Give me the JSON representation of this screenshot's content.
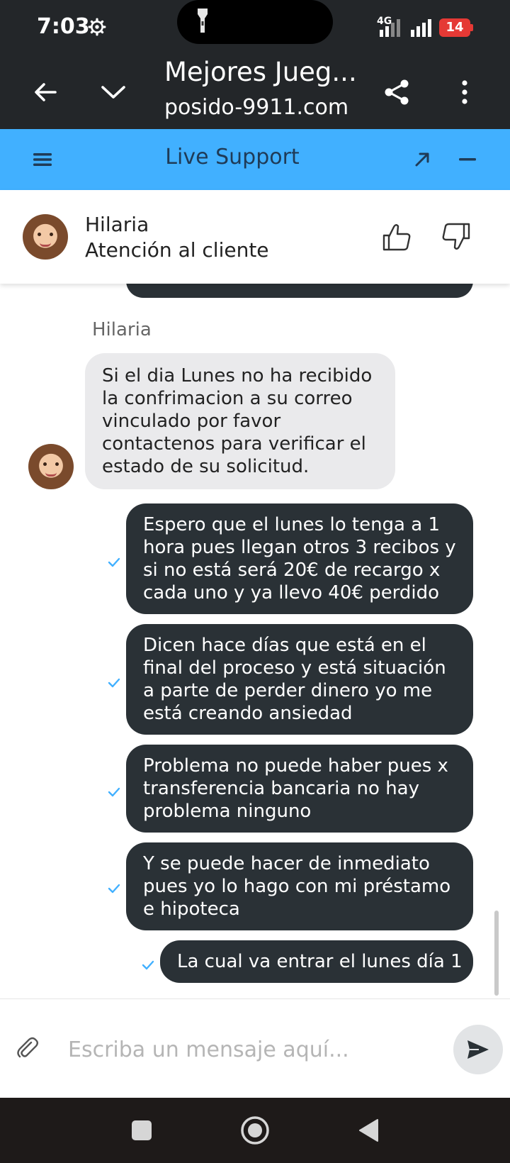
{
  "status_bar": {
    "time": "7:03",
    "network": "4G",
    "battery": "14",
    "icons": [
      "gear-icon",
      "flashlight-icon",
      "signal-icon",
      "battery-icon"
    ]
  },
  "browser": {
    "title": "Mejores Jueg...",
    "url": "posido-9911.com",
    "icons": [
      "back-arrow-icon",
      "chevron-down-icon",
      "share-icon",
      "more-vert-icon"
    ]
  },
  "support": {
    "title": "Live Support",
    "icons": [
      "menu-icon",
      "expand-icon",
      "minimize-icon"
    ]
  },
  "agent": {
    "name": "Hilaria",
    "role": "Atención al cliente",
    "icons": [
      "thumbs-up-icon",
      "thumbs-down-icon"
    ]
  },
  "chat": {
    "sender_label": "Hilaria",
    "messages": [
      {
        "from": "agent",
        "text": "Si el dia Lunes no ha recibido la confrimacion a su correo vinculado por favor contactenos para verificar el estado de su solicitud."
      },
      {
        "from": "user",
        "text": "Espero que el lunes lo tenga a 1 hora pues llegan otros 3 recibos y si no está será 20€ de recargo x cada uno y ya llevo 40€ perdido"
      },
      {
        "from": "user",
        "text": "Dicen hace días que está en el final del proceso y está situación a parte de perder dinero yo me está creando ansiedad"
      },
      {
        "from": "user",
        "text": "Problema no puede haber pues x transferencia bancaria no hay problema ninguno"
      },
      {
        "from": "user",
        "text": "Y se puede hacer de inmediato pues yo lo hago con mi préstamo e hipoteca"
      },
      {
        "from": "user",
        "text": "La cual va entrar el lunes día 1"
      }
    ]
  },
  "composer": {
    "placeholder": "Escriba un mensaje aquí...",
    "value": "",
    "icons": [
      "paperclip-icon",
      "send-icon"
    ]
  },
  "nav": {
    "icons": [
      "recents-icon",
      "home-icon",
      "back-icon"
    ]
  },
  "colors": {
    "dark_bar": "#232629",
    "support_blue": "#41b0ff",
    "user_bubble": "#2a3136",
    "agent_bubble": "#eaeaec",
    "check_blue": "#41b0ff"
  }
}
